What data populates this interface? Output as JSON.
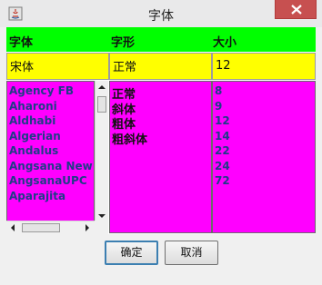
{
  "window": {
    "title": "字体"
  },
  "header": {
    "font_label": "字体",
    "style_label": "字形",
    "size_label": "大小"
  },
  "fields": {
    "font_value": "宋体",
    "style_value": "正常",
    "size_value": "12"
  },
  "lists": {
    "fonts": [
      "Agency FB",
      "Aharoni",
      "Aldhabi",
      "Algerian",
      "Andalus",
      "Angsana New",
      "AngsanaUPC",
      "Aparajita"
    ],
    "styles": [
      "正常",
      "斜体",
      "粗体",
      "粗斜体"
    ],
    "sizes": [
      "8",
      "9",
      "12",
      "14",
      "22",
      "24",
      "72"
    ]
  },
  "buttons": {
    "ok": "确定",
    "cancel": "取消"
  },
  "colors": {
    "header": "#00ff00",
    "field": "#ffff00",
    "list": "#ff00ff",
    "close": "#c75050"
  }
}
